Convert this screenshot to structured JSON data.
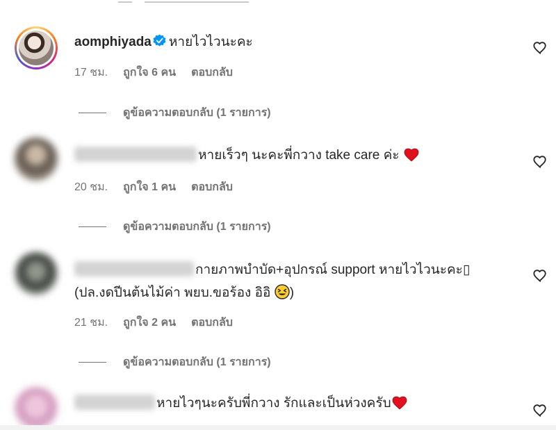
{
  "comments": [
    {
      "username": "aomphiyada",
      "verified": true,
      "text": "หายไวไวนะคะ",
      "time": "17 ชม.",
      "likes": "ถูกใจ 6 คน",
      "reply_label": "ตอบกลับ",
      "view_replies": "ดูข้อความตอบกลับ (1 รายการ)"
    },
    {
      "username_blurred": true,
      "text": "หายเร็วๆ นะคะพี่กวาง take care ค่ะ",
      "time": "20 ชม.",
      "likes": "ถูกใจ 1 คน",
      "reply_label": "ตอบกลับ",
      "view_replies": "ดูข้อความตอบกลับ (1 รายการ)"
    },
    {
      "username_blurred": true,
      "text_line1": "กายภาพบำบัด+อุปกรณ์ support หายไวไวนะคะ▯",
      "text_line2": "(ปล.งดปีนต้นไม้ค่า พยบ.ขอร้อง อิอิ",
      "text_line2_end": ")",
      "time": "21 ชม.",
      "likes": "ถูกใจ 2 คน",
      "reply_label": "ตอบกลับ",
      "view_replies": "ดูข้อความตอบกลับ (1 รายการ)"
    },
    {
      "username_blurred": true,
      "text": "หายไวๆนะครับพี่กวาง รักและเป็นห่วงครับ"
    }
  ],
  "icons": {
    "like": "heart-outline-icon",
    "verified": "verified-badge-icon",
    "emoji_heart": "red-heart-emoji",
    "emoji_face": "laughing-squint-face-emoji"
  },
  "colors": {
    "verified_blue": "#0095f6",
    "muted_text": "#737373",
    "primary_text": "#262626",
    "heart_red": "#e0101f"
  }
}
